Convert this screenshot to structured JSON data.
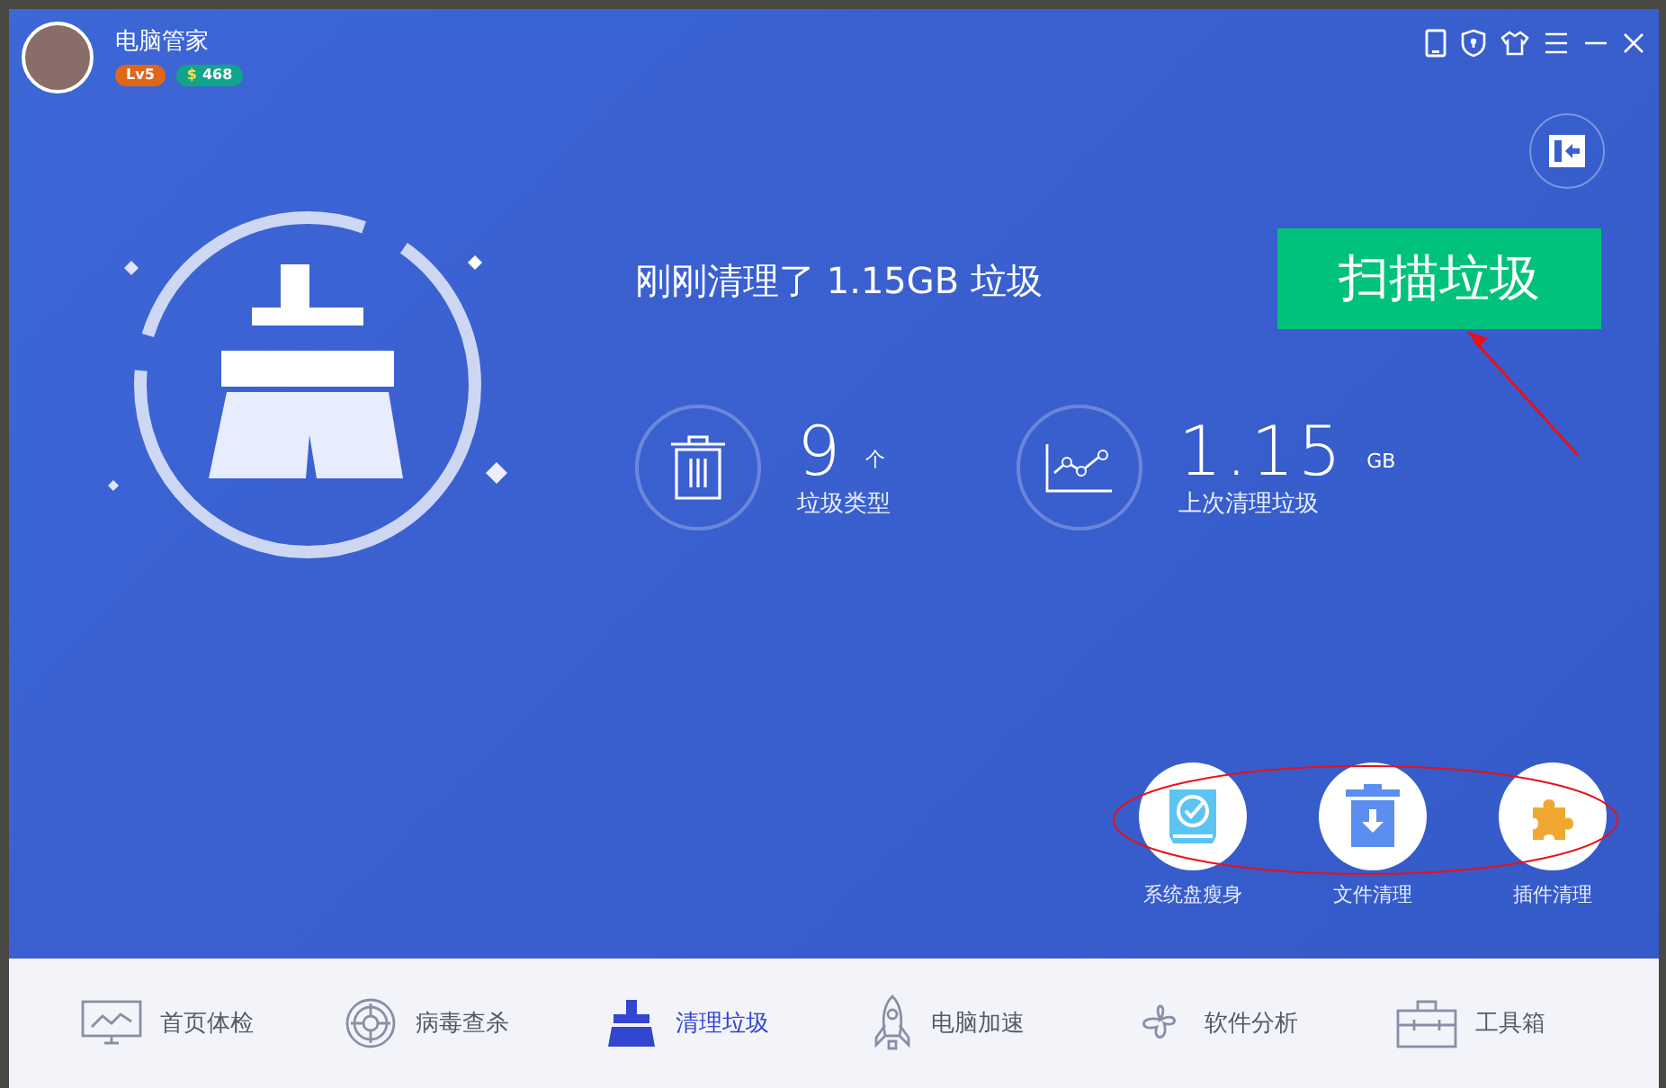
{
  "app": {
    "title": "电脑管家",
    "level_badge": "Lv5",
    "coin_symbol": "$",
    "coins": "468"
  },
  "headline": "刚刚清理了 1.15GB 垃圾",
  "scan_button": "扫描垃圾",
  "stats": [
    {
      "kind": "trash",
      "value": "9",
      "unit": "个",
      "label": "垃圾类型"
    },
    {
      "kind": "chart",
      "value": "1.15",
      "unit": "GB",
      "label": "上次清理垃圾"
    }
  ],
  "tools": [
    {
      "kind": "disk",
      "label": "系统盘瘦身"
    },
    {
      "kind": "file",
      "label": "文件清理"
    },
    {
      "kind": "plugin",
      "label": "插件清理"
    }
  ],
  "nav": [
    {
      "kind": "monitor",
      "label": "首页体检",
      "selected": false
    },
    {
      "kind": "target",
      "label": "病毒查杀",
      "selected": false
    },
    {
      "kind": "broom",
      "label": "清理垃圾",
      "selected": true
    },
    {
      "kind": "rocket",
      "label": "电脑加速",
      "selected": false
    },
    {
      "kind": "clover",
      "label": "软件分析",
      "selected": false
    },
    {
      "kind": "toolbox",
      "label": "工具箱",
      "selected": false
    }
  ]
}
